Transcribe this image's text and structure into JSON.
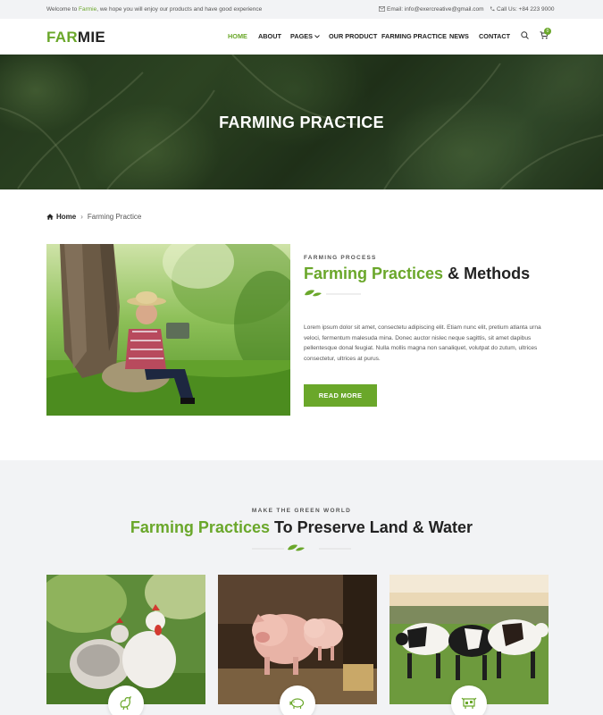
{
  "topbar": {
    "welcome_pre": "Welcome to ",
    "welcome_brand": "Farmie",
    "welcome_post": ", we hope you will enjoy our products and have good experience",
    "email": "Email: info@exercreative@gmail.com",
    "call": "Call Us: +84 223 9000"
  },
  "header": {
    "logo_green": "FAR",
    "logo_dark": "MIE",
    "nav": [
      "HOME",
      "ABOUT",
      "PAGES",
      "OUR PRODUCT",
      "FARMING PRACTICE",
      "NEWS",
      "CONTACT"
    ],
    "active_nav": "HOME",
    "cart_count": "0"
  },
  "hero": {
    "title": "FARMING PRACTICE"
  },
  "breadcrumb": {
    "home": "Home",
    "current": "Farming Practice"
  },
  "intro": {
    "eyebrow": "FARMING PROCESS",
    "title_green": "Farming Practices",
    "title_dark": " & Methods",
    "paragraph": "Lorem ipsum dolor sit amet, consectetu adipiscing elit. Etiam nunc elit, pretium atlanta urna veloci, fermentum malesuda mina. Donec auctor nislec neque sagittis, sit amet dapibus pellentesque donal feugiat. Nulla mollis magna non sanaliquet, volutpat do zutum, ultrices consectetur, ultrices at purus.",
    "button": "READ MORE"
  },
  "practices": {
    "eyebrow": "MAKE THE GREEN WORLD",
    "title_green": "Farming Practices",
    "title_dark": " To Preserve Land & Water",
    "cards": [
      {
        "icon": "chicken-icon"
      },
      {
        "icon": "pig-icon"
      },
      {
        "icon": "cow-icon"
      }
    ]
  },
  "colors": {
    "accent": "#6aa72a",
    "topbar_bg": "#f2f3f5",
    "section_bg": "#f2f3f5"
  }
}
